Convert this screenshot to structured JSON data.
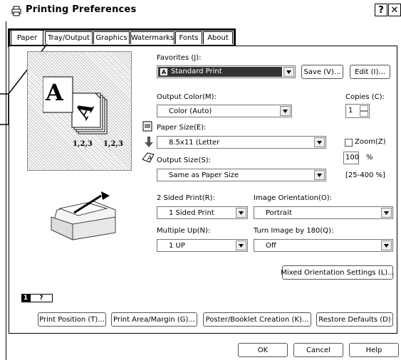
{
  "window": {
    "title": "Printing Preferences",
    "help_glyph": "?",
    "close_glyph": "✕"
  },
  "tabs": [
    "Paper",
    "Tray/Output",
    "Graphics",
    "Watermarks",
    "Fonts",
    "About"
  ],
  "active_tab": "Paper",
  "preview": {
    "page_letter": "A",
    "label_left": "1,2,3",
    "label_right": "1,2,3"
  },
  "favorites": {
    "label": "Favorites (J):",
    "value": "Standard Print",
    "save": "Save (V)...",
    "edit": "Edit (I)..."
  },
  "output_color": {
    "label": "Output Color(M):",
    "value": "Color (Auto)"
  },
  "copies": {
    "label": "Copies (C):",
    "value": "1"
  },
  "paper_size": {
    "label": "Paper Size(E):",
    "value": "8.5x11 (Letter"
  },
  "zoom": {
    "label": "Zoom(Z)",
    "value": "100",
    "unit": "%",
    "range": "[25-400 %]"
  },
  "output_size": {
    "label": "Output Size(S):",
    "value": "Same as Paper Size"
  },
  "sided_print": {
    "label": "2 Sided Print(R):",
    "value": "1 Sided Print"
  },
  "image_orientation": {
    "label": "Image Orientation(O):",
    "value": "Portrait"
  },
  "multiple_up": {
    "label": "Multiple Up(N):",
    "value": "1 UP"
  },
  "turn_image": {
    "label": "Turn Image by 180(Q):",
    "value": "Off"
  },
  "mixed_orientation": "Mixed Orientation Settings (L)...",
  "page_badge": {
    "num": "1",
    "q": "?"
  },
  "bottom_buttons": [
    "Print Position (T)...",
    "Print Area/Margin (G)...",
    "Poster/Booklet Creation (K)...",
    "Restore Defaults (D)"
  ],
  "dialog_buttons": {
    "ok": "OK",
    "cancel": "Cancel",
    "help": "Help"
  }
}
